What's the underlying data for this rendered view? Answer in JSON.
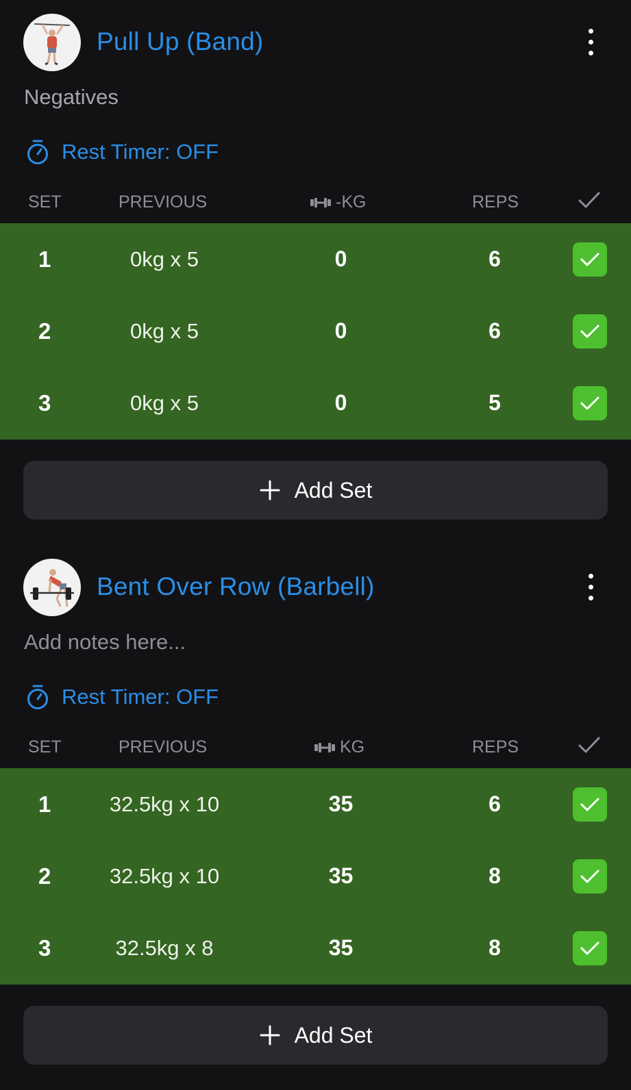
{
  "exercises": [
    {
      "title": "Pull Up (Band)",
      "notes": "Negatives",
      "rest_timer": "Rest Timer: OFF",
      "columns": {
        "set": "SET",
        "previous": "PREVIOUS",
        "weight": "-KG",
        "reps": "REPS"
      },
      "sets": [
        {
          "set": "1",
          "previous": "0kg x 5",
          "kg": "0",
          "reps": "6",
          "done": true
        },
        {
          "set": "2",
          "previous": "0kg x 5",
          "kg": "0",
          "reps": "6",
          "done": true
        },
        {
          "set": "3",
          "previous": "0kg x 5",
          "kg": "0",
          "reps": "5",
          "done": true
        }
      ],
      "add_set": "Add Set"
    },
    {
      "title": "Bent Over Row (Barbell)",
      "notes_placeholder": "Add notes here...",
      "rest_timer": "Rest Timer: OFF",
      "columns": {
        "set": "SET",
        "previous": "PREVIOUS",
        "weight": "KG",
        "reps": "REPS"
      },
      "sets": [
        {
          "set": "1",
          "previous": "32.5kg x 10",
          "kg": "35",
          "reps": "6",
          "done": true
        },
        {
          "set": "2",
          "previous": "32.5kg x 10",
          "kg": "35",
          "reps": "8",
          "done": true
        },
        {
          "set": "3",
          "previous": "32.5kg x 8",
          "kg": "35",
          "reps": "8",
          "done": true
        }
      ],
      "add_set": "Add Set"
    }
  ],
  "colors": {
    "background": "#121214",
    "accent_blue": "#2b8ee6",
    "completed_row": "#346522",
    "check_green": "#4ec02f",
    "button_bg": "#2a2a2e"
  },
  "icons": {
    "menu": "more-vertical-icon",
    "timer": "stopwatch-icon",
    "weight": "dumbbell-icon",
    "check": "checkmark-icon",
    "add": "plus-icon"
  }
}
